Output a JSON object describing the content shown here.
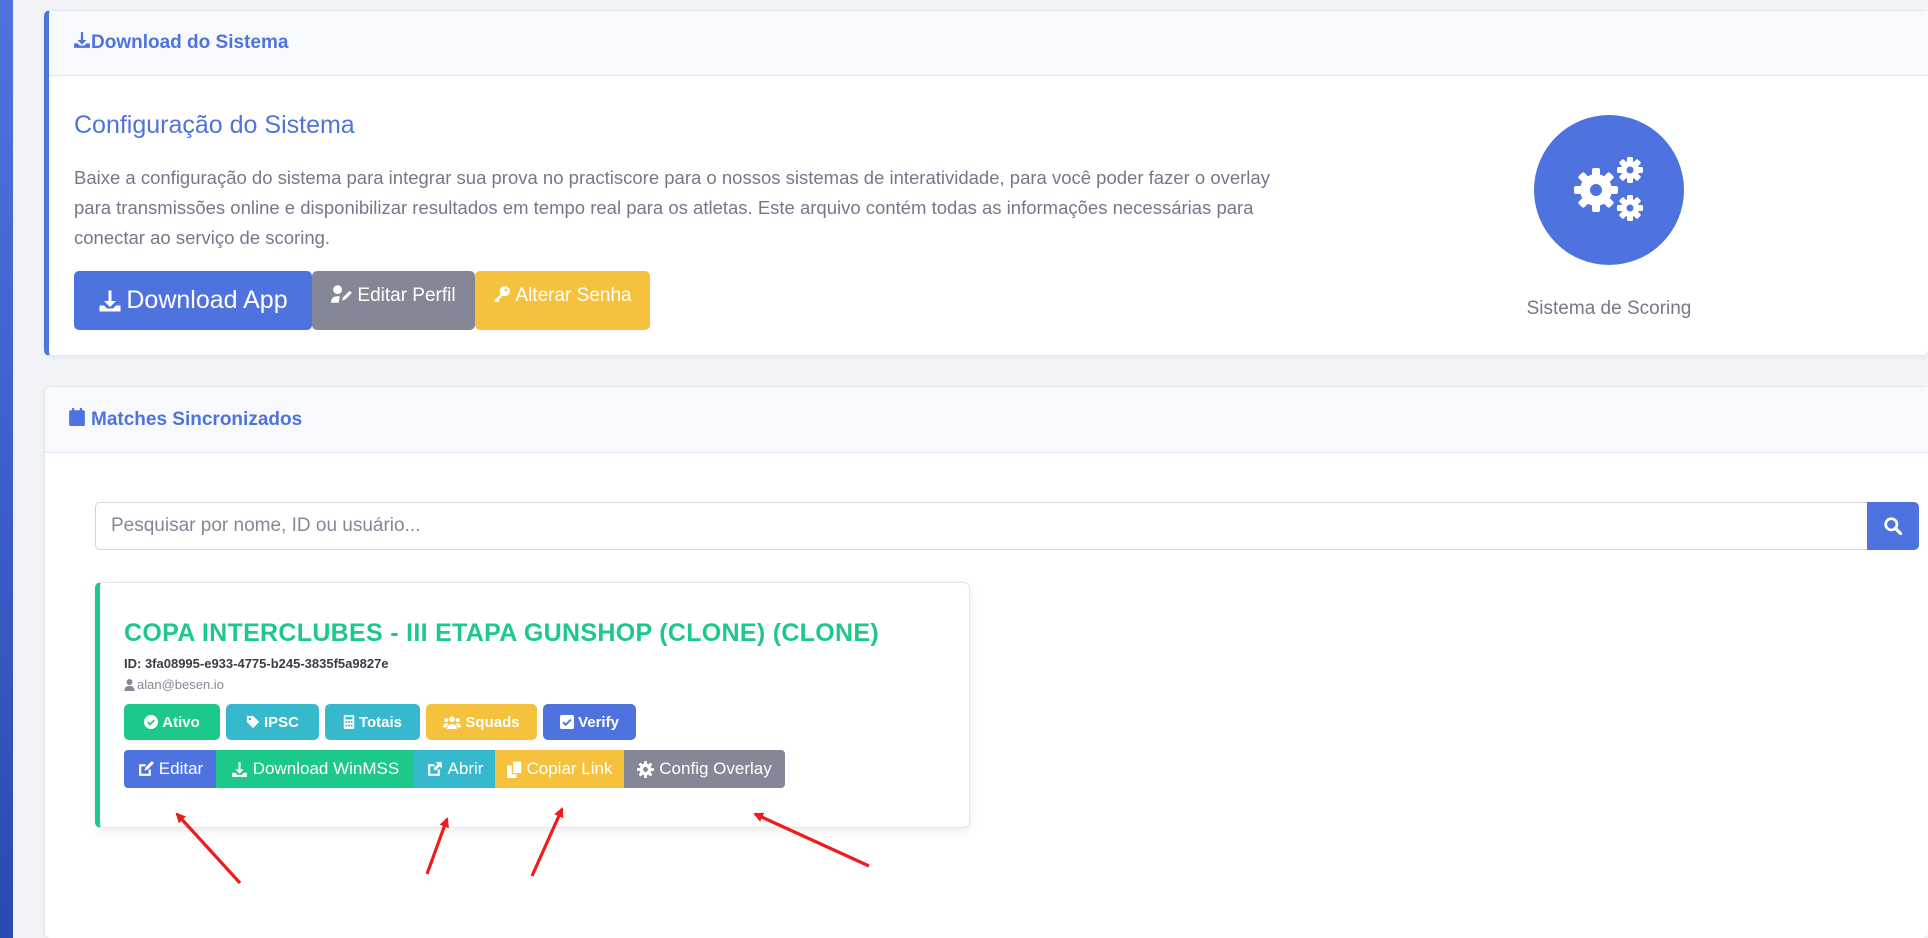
{
  "download_card": {
    "header_title": "Download do Sistema",
    "config_title": "Configuração do Sistema",
    "description": "Baixe a configuração do sistema para integrar sua prova no practiscore para o nossos sistemas de interatividade, para você poder fazer o overlay para transmissões online e disponibilizar resultados em tempo real para os atletas. Este arquivo contém todas as informações necessárias para conectar ao serviço de scoring.",
    "buttons": {
      "download_app": "Download App",
      "edit_profile": "Editar Perfil",
      "change_password": "Alterar Senha"
    },
    "scoring_label": "Sistema de Scoring"
  },
  "matches_card": {
    "header_title": "Matches Sincronizados",
    "search": {
      "placeholder": "Pesquisar por nome, ID ou usuário...",
      "value": ""
    },
    "matches": [
      {
        "title": "COPA INTERCLUBES - III ETAPA GUNSHOP (CLONE) (CLONE)",
        "id_text": "ID: 3fa08995-e933-4775-b245-3835f5a9827e",
        "user": "alan@besen.io",
        "badges": {
          "status": "Ativo",
          "type": "IPSC",
          "totals": "Totais",
          "squads": "Squads",
          "verify": "Verify"
        },
        "actions": {
          "edit": "Editar",
          "download_winmss": "Download WinMSS",
          "open": "Abrir",
          "copy_link": "Copiar Link",
          "config_overlay": "Config Overlay"
        }
      }
    ]
  },
  "colors": {
    "primary": "#4e73df",
    "success": "#1cc88a",
    "info": "#36b9cc",
    "warning": "#f6c23e",
    "secondary": "#858796",
    "annotation_arrow": "#ee1c1c"
  },
  "icons": {
    "header_download": "download-icon",
    "header_matches": "calendar-icon",
    "scoring": "gears-icon",
    "search": "search-icon"
  }
}
